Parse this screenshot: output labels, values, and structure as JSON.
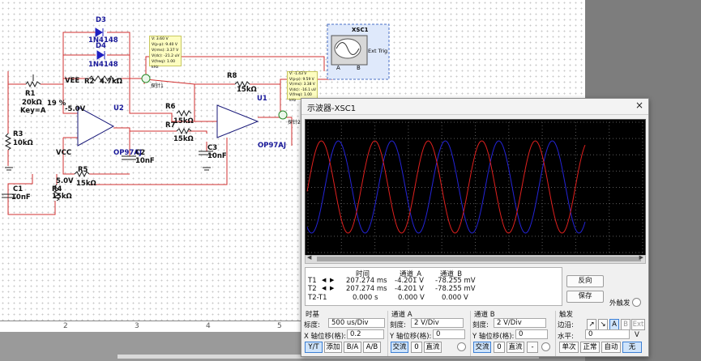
{
  "schematic": {
    "diodes": [
      {
        "ref": "D3",
        "model": "1N4148"
      },
      {
        "ref": "D4",
        "model": "1N4148"
      }
    ],
    "r1": {
      "ref": "R1",
      "value": "20kΩ",
      "key": "Key=A",
      "percent": "19 %"
    },
    "r2": {
      "ref": "R2",
      "value": "4.7kΩ"
    },
    "r3": {
      "ref": "R3",
      "value": "10kΩ"
    },
    "r4": {
      "ref": "R4",
      "value": "15kΩ"
    },
    "r5": {
      "ref": "R5",
      "value": "15kΩ"
    },
    "r6": {
      "ref": "R6",
      "value": "15kΩ"
    },
    "r7": {
      "ref": "R7",
      "value": "15kΩ"
    },
    "r8": {
      "ref": "R8",
      "value": "15kΩ"
    },
    "c1": {
      "ref": "C1",
      "value": "10nF"
    },
    "c2": {
      "ref": "C2",
      "value": "10nF"
    },
    "c3": {
      "ref": "C3",
      "value": "10nF"
    },
    "u1": {
      "ref": "U1",
      "model": "OP97AJ"
    },
    "u2": {
      "ref": "U2",
      "model": "OP97AJ"
    },
    "vee": {
      "label": "VEE",
      "value": "-5.0V"
    },
    "vcc": {
      "label": "VCC",
      "value": "5.0V"
    },
    "probe1": {
      "lines": [
        "V: 3.60 V",
        "V(p-p): 9.40 V",
        "V(rms): 3.37 V",
        "V(dc): -21.2 uV",
        "V(freq): 1.00 kHz"
      ],
      "tag": "探针1"
    },
    "probe2": {
      "lines": [
        "V: -1.43 V",
        "V(p-p): 9.59 V",
        "V(rms): 3.38 V",
        "V(dc): -16.1 uV",
        "V(freq): 1.00 kHz"
      ],
      "tag": "探针2"
    },
    "scope_block": {
      "ref": "XSC1",
      "a": "A",
      "b": "B",
      "ext_trig": "Ext Trig"
    },
    "ruler_ticks": [
      "2",
      "3",
      "4",
      "5"
    ]
  },
  "scope": {
    "title": "示波器-XSC1",
    "close_icon": "×",
    "readout": {
      "headers": [
        "时间",
        "通道_A",
        "通道_B"
      ],
      "rows": [
        {
          "label": "T1",
          "time": "207.274 ms",
          "a": "-4.201 V",
          "b": "-78.255 mV"
        },
        {
          "label": "T2",
          "time": "207.274 ms",
          "a": "-4.201 V",
          "b": "-78.255 mV"
        },
        {
          "label": "T2-T1",
          "time": "0.000 s",
          "a": "0.000 V",
          "b": "0.000 V"
        }
      ]
    },
    "reverse_label": "反向",
    "save_label": "保存",
    "ext_trigger_label": "外触发",
    "timebase": {
      "title": "时基",
      "scale_label": "标度:",
      "scale_value": "500 us/Div",
      "xpos_label": "X 轴位移(格):",
      "xpos_value": "0.2",
      "modes": [
        "Y/T",
        "添加",
        "B/A",
        "A/B"
      ],
      "selected_mode": "Y/T"
    },
    "channel_a": {
      "title": "通道 A",
      "scale_label": "刻度:",
      "scale_value": "2  V/Div",
      "ypos_label": "Y 轴位移(格):",
      "ypos_value": "0",
      "coupling": [
        "交流",
        "0",
        "直流"
      ],
      "selected": "交流"
    },
    "channel_b": {
      "title": "通道 B",
      "scale_label": "刻度:",
      "scale_value": "2  V/Div",
      "ypos_label": "Y 轴位移(格):",
      "ypos_value": "0",
      "coupling": [
        "交流",
        "0",
        "直流",
        "-"
      ],
      "selected": "交流"
    },
    "trigger": {
      "title": "触发",
      "edge_label": "边沿:",
      "edge_buttons": [
        "↗",
        "↘",
        "A",
        "B",
        "Ext"
      ],
      "selected_edge": "A",
      "level_label": "水平:",
      "level_value": "0",
      "level_unit": "V",
      "modes": [
        "单次",
        "正常",
        "自动",
        "无"
      ],
      "selected_mode": "无"
    },
    "colors": {
      "channel_a": "#e0201e",
      "channel_b": "#2424d8",
      "grid": "#5a5a5a"
    }
  }
}
